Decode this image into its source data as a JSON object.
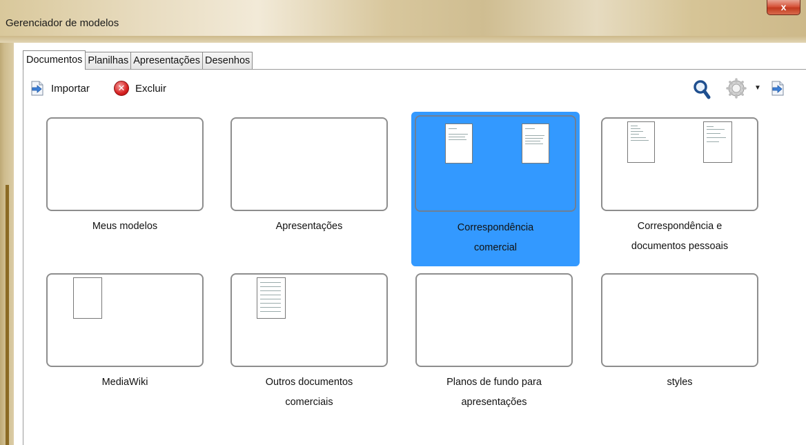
{
  "window": {
    "title": "Gerenciador de modelos",
    "close_label": "x"
  },
  "tabs": [
    {
      "label": "Documentos",
      "active": true
    },
    {
      "label": "Planilhas",
      "active": false
    },
    {
      "label": "Apresentações",
      "active": false
    },
    {
      "label": "Desenhos",
      "active": false
    }
  ],
  "toolbar": {
    "import_label": "Importar",
    "delete_label": "Excluir",
    "import_icon": "import-arrow-icon",
    "delete_icon": "red-x-circle-icon",
    "search_icon": "magnifier-icon",
    "settings_icon": "gear-icon",
    "more_icon": "arrow-icon"
  },
  "folders": [
    {
      "line1": "Meus modelos",
      "line2": "",
      "selected": false,
      "docs": 0
    },
    {
      "line1": "Apresentações",
      "line2": "",
      "selected": false,
      "docs": 0
    },
    {
      "line1": "Correspondência",
      "line2": "comercial",
      "selected": true,
      "docs": 2
    },
    {
      "line1": "Correspondência e",
      "line2": "documentos pessoais",
      "selected": false,
      "docs": 2
    },
    {
      "line1": "MediaWiki",
      "line2": "",
      "selected": false,
      "docs": 1
    },
    {
      "line1": "Outros documentos",
      "line2": "comerciais",
      "selected": false,
      "docs": 1
    },
    {
      "line1": "Planos de fundo para",
      "line2": "apresentações",
      "selected": false,
      "docs": 0
    },
    {
      "line1": "styles",
      "line2": "",
      "selected": false,
      "docs": 0
    }
  ],
  "colors": {
    "selection": "#3399ff",
    "frame": "#d9c89b"
  }
}
